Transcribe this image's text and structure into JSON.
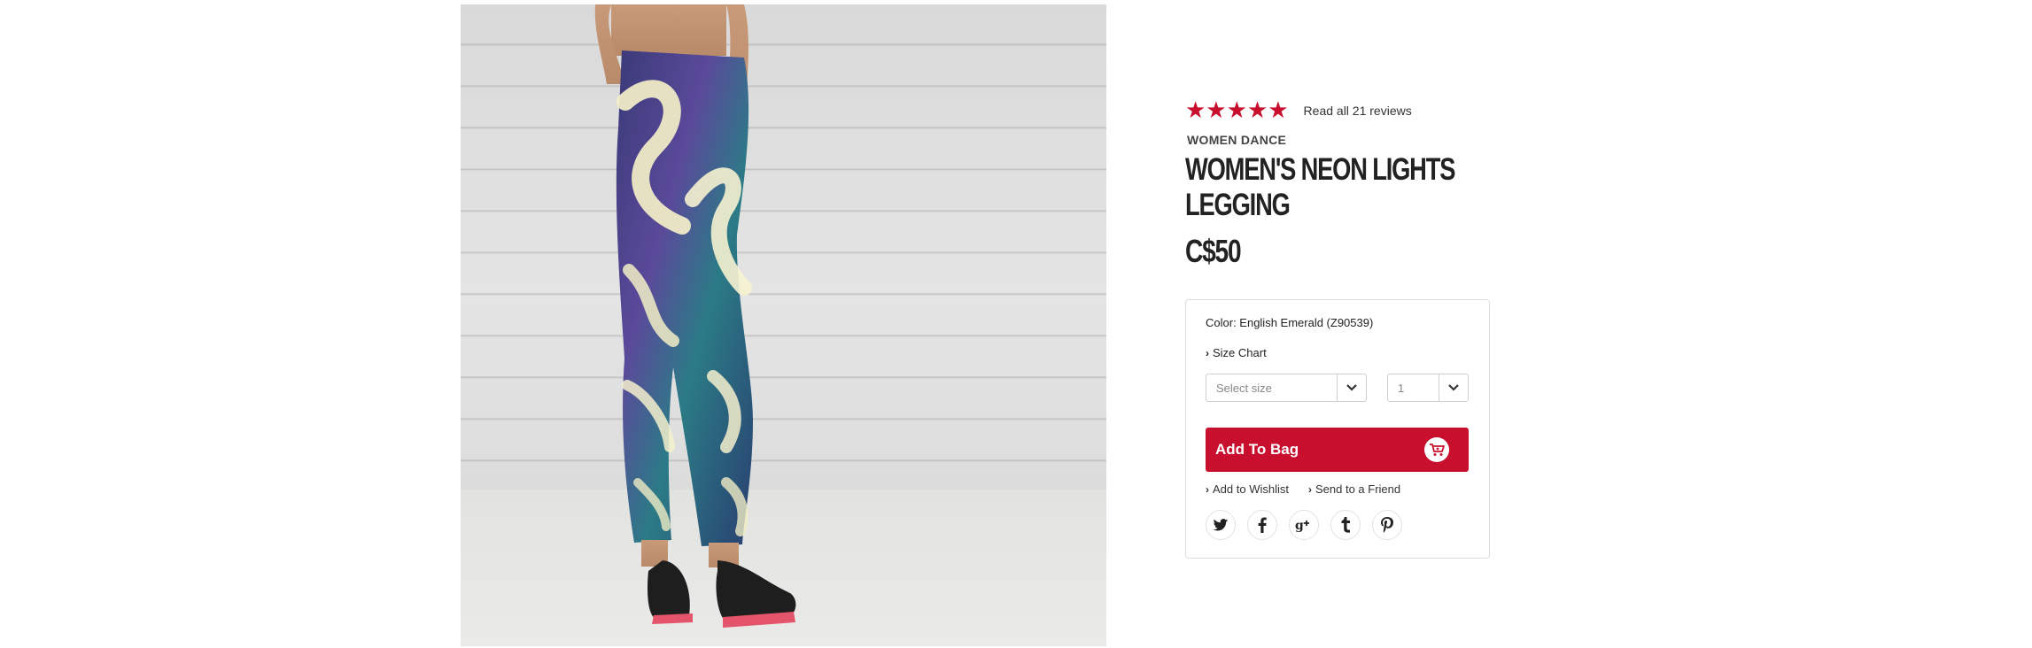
{
  "product": {
    "rating_stars": "★★★★★",
    "reviews_link": "Read all 21 reviews",
    "category": "WOMEN DANCE",
    "name_line1": "WOMEN'S NEON LIGHTS",
    "name_line2": "LEGGING",
    "price": "C$50",
    "rating": 5
  },
  "options": {
    "color_label": "Color: English Emerald (Z90539)",
    "size_chart": "Size Chart",
    "size_placeholder": "Select size",
    "quantity": "1",
    "add_to_bag": "Add To Bag",
    "add_to_wishlist": "Add to Wishlist",
    "send_to_friend": "Send to a Friend"
  },
  "social": {
    "twitter": "twitter-icon",
    "facebook": "facebook-icon",
    "google_plus": "google-plus-icon",
    "tumblr": "tumblr-icon",
    "pinterest": "pinterest-icon"
  },
  "colors": {
    "accent": "#c8102e",
    "text": "#222222",
    "border": "#dedede"
  }
}
